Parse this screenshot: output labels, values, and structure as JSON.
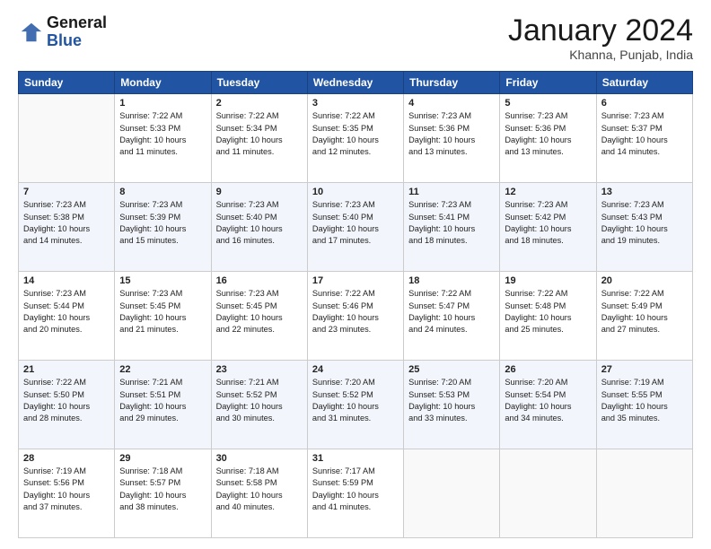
{
  "header": {
    "logo_general": "General",
    "logo_blue": "Blue",
    "month_title": "January 2024",
    "location": "Khanna, Punjab, India"
  },
  "days_of_week": [
    "Sunday",
    "Monday",
    "Tuesday",
    "Wednesday",
    "Thursday",
    "Friday",
    "Saturday"
  ],
  "weeks": [
    [
      {
        "day": "",
        "info": ""
      },
      {
        "day": "1",
        "info": "Sunrise: 7:22 AM\nSunset: 5:33 PM\nDaylight: 10 hours\nand 11 minutes."
      },
      {
        "day": "2",
        "info": "Sunrise: 7:22 AM\nSunset: 5:34 PM\nDaylight: 10 hours\nand 11 minutes."
      },
      {
        "day": "3",
        "info": "Sunrise: 7:22 AM\nSunset: 5:35 PM\nDaylight: 10 hours\nand 12 minutes."
      },
      {
        "day": "4",
        "info": "Sunrise: 7:23 AM\nSunset: 5:36 PM\nDaylight: 10 hours\nand 13 minutes."
      },
      {
        "day": "5",
        "info": "Sunrise: 7:23 AM\nSunset: 5:36 PM\nDaylight: 10 hours\nand 13 minutes."
      },
      {
        "day": "6",
        "info": "Sunrise: 7:23 AM\nSunset: 5:37 PM\nDaylight: 10 hours\nand 14 minutes."
      }
    ],
    [
      {
        "day": "7",
        "info": "Sunrise: 7:23 AM\nSunset: 5:38 PM\nDaylight: 10 hours\nand 14 minutes."
      },
      {
        "day": "8",
        "info": "Sunrise: 7:23 AM\nSunset: 5:39 PM\nDaylight: 10 hours\nand 15 minutes."
      },
      {
        "day": "9",
        "info": "Sunrise: 7:23 AM\nSunset: 5:40 PM\nDaylight: 10 hours\nand 16 minutes."
      },
      {
        "day": "10",
        "info": "Sunrise: 7:23 AM\nSunset: 5:40 PM\nDaylight: 10 hours\nand 17 minutes."
      },
      {
        "day": "11",
        "info": "Sunrise: 7:23 AM\nSunset: 5:41 PM\nDaylight: 10 hours\nand 18 minutes."
      },
      {
        "day": "12",
        "info": "Sunrise: 7:23 AM\nSunset: 5:42 PM\nDaylight: 10 hours\nand 18 minutes."
      },
      {
        "day": "13",
        "info": "Sunrise: 7:23 AM\nSunset: 5:43 PM\nDaylight: 10 hours\nand 19 minutes."
      }
    ],
    [
      {
        "day": "14",
        "info": "Sunrise: 7:23 AM\nSunset: 5:44 PM\nDaylight: 10 hours\nand 20 minutes."
      },
      {
        "day": "15",
        "info": "Sunrise: 7:23 AM\nSunset: 5:45 PM\nDaylight: 10 hours\nand 21 minutes."
      },
      {
        "day": "16",
        "info": "Sunrise: 7:23 AM\nSunset: 5:45 PM\nDaylight: 10 hours\nand 22 minutes."
      },
      {
        "day": "17",
        "info": "Sunrise: 7:22 AM\nSunset: 5:46 PM\nDaylight: 10 hours\nand 23 minutes."
      },
      {
        "day": "18",
        "info": "Sunrise: 7:22 AM\nSunset: 5:47 PM\nDaylight: 10 hours\nand 24 minutes."
      },
      {
        "day": "19",
        "info": "Sunrise: 7:22 AM\nSunset: 5:48 PM\nDaylight: 10 hours\nand 25 minutes."
      },
      {
        "day": "20",
        "info": "Sunrise: 7:22 AM\nSunset: 5:49 PM\nDaylight: 10 hours\nand 27 minutes."
      }
    ],
    [
      {
        "day": "21",
        "info": "Sunrise: 7:22 AM\nSunset: 5:50 PM\nDaylight: 10 hours\nand 28 minutes."
      },
      {
        "day": "22",
        "info": "Sunrise: 7:21 AM\nSunset: 5:51 PM\nDaylight: 10 hours\nand 29 minutes."
      },
      {
        "day": "23",
        "info": "Sunrise: 7:21 AM\nSunset: 5:52 PM\nDaylight: 10 hours\nand 30 minutes."
      },
      {
        "day": "24",
        "info": "Sunrise: 7:20 AM\nSunset: 5:52 PM\nDaylight: 10 hours\nand 31 minutes."
      },
      {
        "day": "25",
        "info": "Sunrise: 7:20 AM\nSunset: 5:53 PM\nDaylight: 10 hours\nand 33 minutes."
      },
      {
        "day": "26",
        "info": "Sunrise: 7:20 AM\nSunset: 5:54 PM\nDaylight: 10 hours\nand 34 minutes."
      },
      {
        "day": "27",
        "info": "Sunrise: 7:19 AM\nSunset: 5:55 PM\nDaylight: 10 hours\nand 35 minutes."
      }
    ],
    [
      {
        "day": "28",
        "info": "Sunrise: 7:19 AM\nSunset: 5:56 PM\nDaylight: 10 hours\nand 37 minutes."
      },
      {
        "day": "29",
        "info": "Sunrise: 7:18 AM\nSunset: 5:57 PM\nDaylight: 10 hours\nand 38 minutes."
      },
      {
        "day": "30",
        "info": "Sunrise: 7:18 AM\nSunset: 5:58 PM\nDaylight: 10 hours\nand 40 minutes."
      },
      {
        "day": "31",
        "info": "Sunrise: 7:17 AM\nSunset: 5:59 PM\nDaylight: 10 hours\nand 41 minutes."
      },
      {
        "day": "",
        "info": ""
      },
      {
        "day": "",
        "info": ""
      },
      {
        "day": "",
        "info": ""
      }
    ]
  ]
}
